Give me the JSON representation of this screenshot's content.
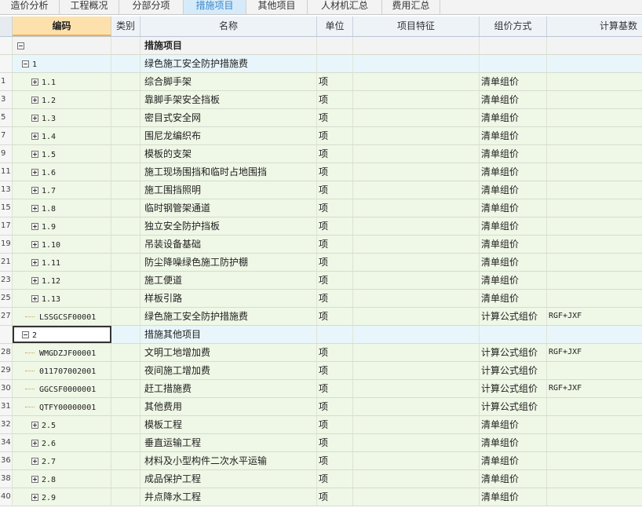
{
  "tabs": [
    {
      "label": "造价分析",
      "active": false
    },
    {
      "label": "工程概况",
      "active": false
    },
    {
      "label": "分部分项",
      "active": false
    },
    {
      "label": "措施项目",
      "active": true
    },
    {
      "label": "其他项目",
      "active": false
    },
    {
      "label": "人材机汇总",
      "active": false
    },
    {
      "label": "费用汇总",
      "active": false
    }
  ],
  "columns": {
    "code": "编码",
    "type": "类别",
    "name": "名称",
    "unit": "单位",
    "feature": "项目特征",
    "method": "组价方式",
    "base": "计算基数"
  },
  "rows": [
    {
      "num": "",
      "code": "",
      "toggle": "minus",
      "level": 0,
      "name": "措施项目",
      "unit": "",
      "method": "",
      "base": "",
      "bold": true,
      "style": "top"
    },
    {
      "num": "",
      "code": "1",
      "toggle": "minus",
      "level": 1,
      "name": "绿色施工安全防护措施费",
      "unit": "",
      "method": "",
      "base": "",
      "style": "lvl1"
    },
    {
      "num": "1",
      "code": "1.1",
      "toggle": "plus",
      "level": 2,
      "name": "综合脚手架",
      "unit": "项",
      "method": "清单组价",
      "base": ""
    },
    {
      "num": "3",
      "code": "1.2",
      "toggle": "plus",
      "level": 2,
      "name": "靠脚手架安全挡板",
      "unit": "项",
      "method": "清单组价",
      "base": ""
    },
    {
      "num": "5",
      "code": "1.3",
      "toggle": "plus",
      "level": 2,
      "name": "密目式安全网",
      "unit": "项",
      "method": "清单组价",
      "base": ""
    },
    {
      "num": "7",
      "code": "1.4",
      "toggle": "plus",
      "level": 2,
      "name": "围尼龙编织布",
      "unit": "项",
      "method": "清单组价",
      "base": ""
    },
    {
      "num": "9",
      "code": "1.5",
      "toggle": "plus",
      "level": 2,
      "name": "模板的支架",
      "unit": "项",
      "method": "清单组价",
      "base": ""
    },
    {
      "num": "11",
      "code": "1.6",
      "toggle": "plus",
      "level": 2,
      "name": "施工现场围挡和临时占地围挡",
      "unit": "项",
      "method": "清单组价",
      "base": ""
    },
    {
      "num": "13",
      "code": "1.7",
      "toggle": "plus",
      "level": 2,
      "name": "施工围挡照明",
      "unit": "项",
      "method": "清单组价",
      "base": ""
    },
    {
      "num": "15",
      "code": "1.8",
      "toggle": "plus",
      "level": 2,
      "name": "临时钢管架通道",
      "unit": "项",
      "method": "清单组价",
      "base": ""
    },
    {
      "num": "17",
      "code": "1.9",
      "toggle": "plus",
      "level": 2,
      "name": "独立安全防护挡板",
      "unit": "项",
      "method": "清单组价",
      "base": ""
    },
    {
      "num": "19",
      "code": "1.10",
      "toggle": "plus",
      "level": 2,
      "name": "吊装设备基础",
      "unit": "项",
      "method": "清单组价",
      "base": ""
    },
    {
      "num": "21",
      "code": "1.11",
      "toggle": "plus",
      "level": 2,
      "name": "防尘降噪绿色施工防护棚",
      "unit": "项",
      "method": "清单组价",
      "base": ""
    },
    {
      "num": "23",
      "code": "1.12",
      "toggle": "plus",
      "level": 2,
      "name": "施工便道",
      "unit": "项",
      "method": "清单组价",
      "base": ""
    },
    {
      "num": "25",
      "code": "1.13",
      "toggle": "plus",
      "level": 2,
      "name": "样板引路",
      "unit": "项",
      "method": "清单组价",
      "base": ""
    },
    {
      "num": "27",
      "code": "LSSGCSF00001",
      "toggle": "leaf",
      "level": 2,
      "name": "绿色施工安全防护措施费",
      "unit": "项",
      "method": "计算公式组价",
      "base": "RGF+JXF"
    },
    {
      "num": "",
      "code": "2",
      "toggle": "minus",
      "level": 1,
      "name": "措施其他项目",
      "unit": "",
      "method": "",
      "base": "",
      "style": "lvl1",
      "selected": true
    },
    {
      "num": "28",
      "code": "WMGDZJF00001",
      "toggle": "leaf",
      "level": 2,
      "name": "文明工地增加费",
      "unit": "项",
      "method": "计算公式组价",
      "base": "RGF+JXF"
    },
    {
      "num": "29",
      "code": "011707002001",
      "toggle": "leaf",
      "level": 2,
      "name": "夜间施工增加费",
      "unit": "项",
      "method": "计算公式组价",
      "base": ""
    },
    {
      "num": "30",
      "code": "GGCSF0000001",
      "toggle": "leaf",
      "level": 2,
      "name": "赶工措施费",
      "unit": "项",
      "method": "计算公式组价",
      "base": "RGF+JXF"
    },
    {
      "num": "31",
      "code": "QTFY00000001",
      "toggle": "leaf",
      "level": 2,
      "name": "其他费用",
      "unit": "项",
      "method": "计算公式组价",
      "base": ""
    },
    {
      "num": "32",
      "code": "2.5",
      "toggle": "plus",
      "level": 2,
      "name": "模板工程",
      "unit": "项",
      "method": "清单组价",
      "base": ""
    },
    {
      "num": "34",
      "code": "2.6",
      "toggle": "plus",
      "level": 2,
      "name": "垂直运输工程",
      "unit": "项",
      "method": "清单组价",
      "base": ""
    },
    {
      "num": "36",
      "code": "2.7",
      "toggle": "plus",
      "level": 2,
      "name": "材料及小型构件二次水平运输",
      "unit": "项",
      "method": "清单组价",
      "base": ""
    },
    {
      "num": "38",
      "code": "2.8",
      "toggle": "plus",
      "level": 2,
      "name": "成品保护工程",
      "unit": "项",
      "method": "清单组价",
      "base": ""
    },
    {
      "num": "40",
      "code": "2.9",
      "toggle": "plus",
      "level": 2,
      "name": "井点降水工程",
      "unit": "项",
      "method": "清单组价",
      "base": ""
    }
  ]
}
